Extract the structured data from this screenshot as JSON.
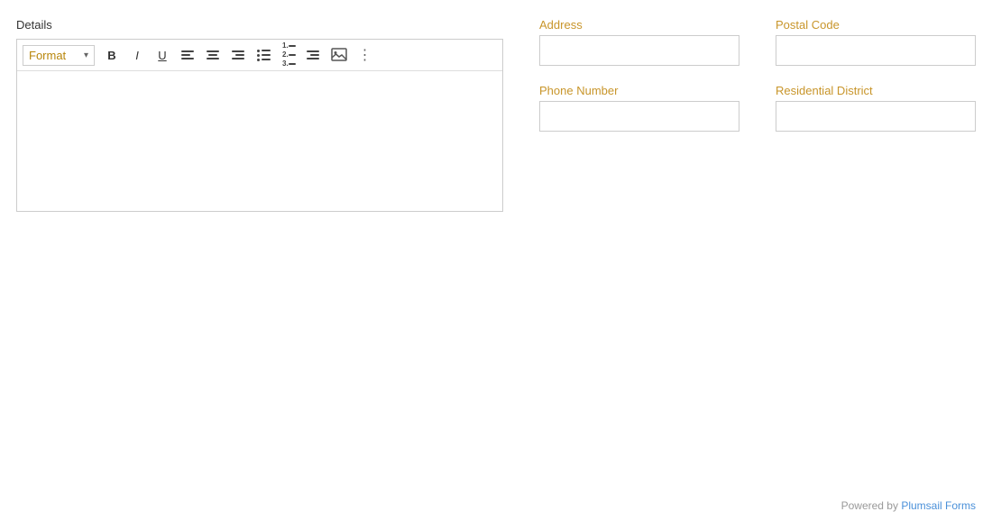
{
  "page": {
    "details_label": "Details",
    "format_label": "Format",
    "toolbar": {
      "bold_label": "B",
      "italic_label": "I",
      "underline_label": "U",
      "more_label": "⋮"
    },
    "fields": {
      "address": {
        "label": "Address",
        "placeholder": ""
      },
      "postal_code": {
        "label": "Postal Code",
        "placeholder": ""
      },
      "phone_number": {
        "label": "Phone Number",
        "placeholder": ""
      },
      "residential_district": {
        "label": "Residential District",
        "placeholder": ""
      }
    },
    "footer": {
      "powered_by": "Powered by ",
      "link_text": "Plumsail Forms",
      "link_url": "#"
    }
  }
}
